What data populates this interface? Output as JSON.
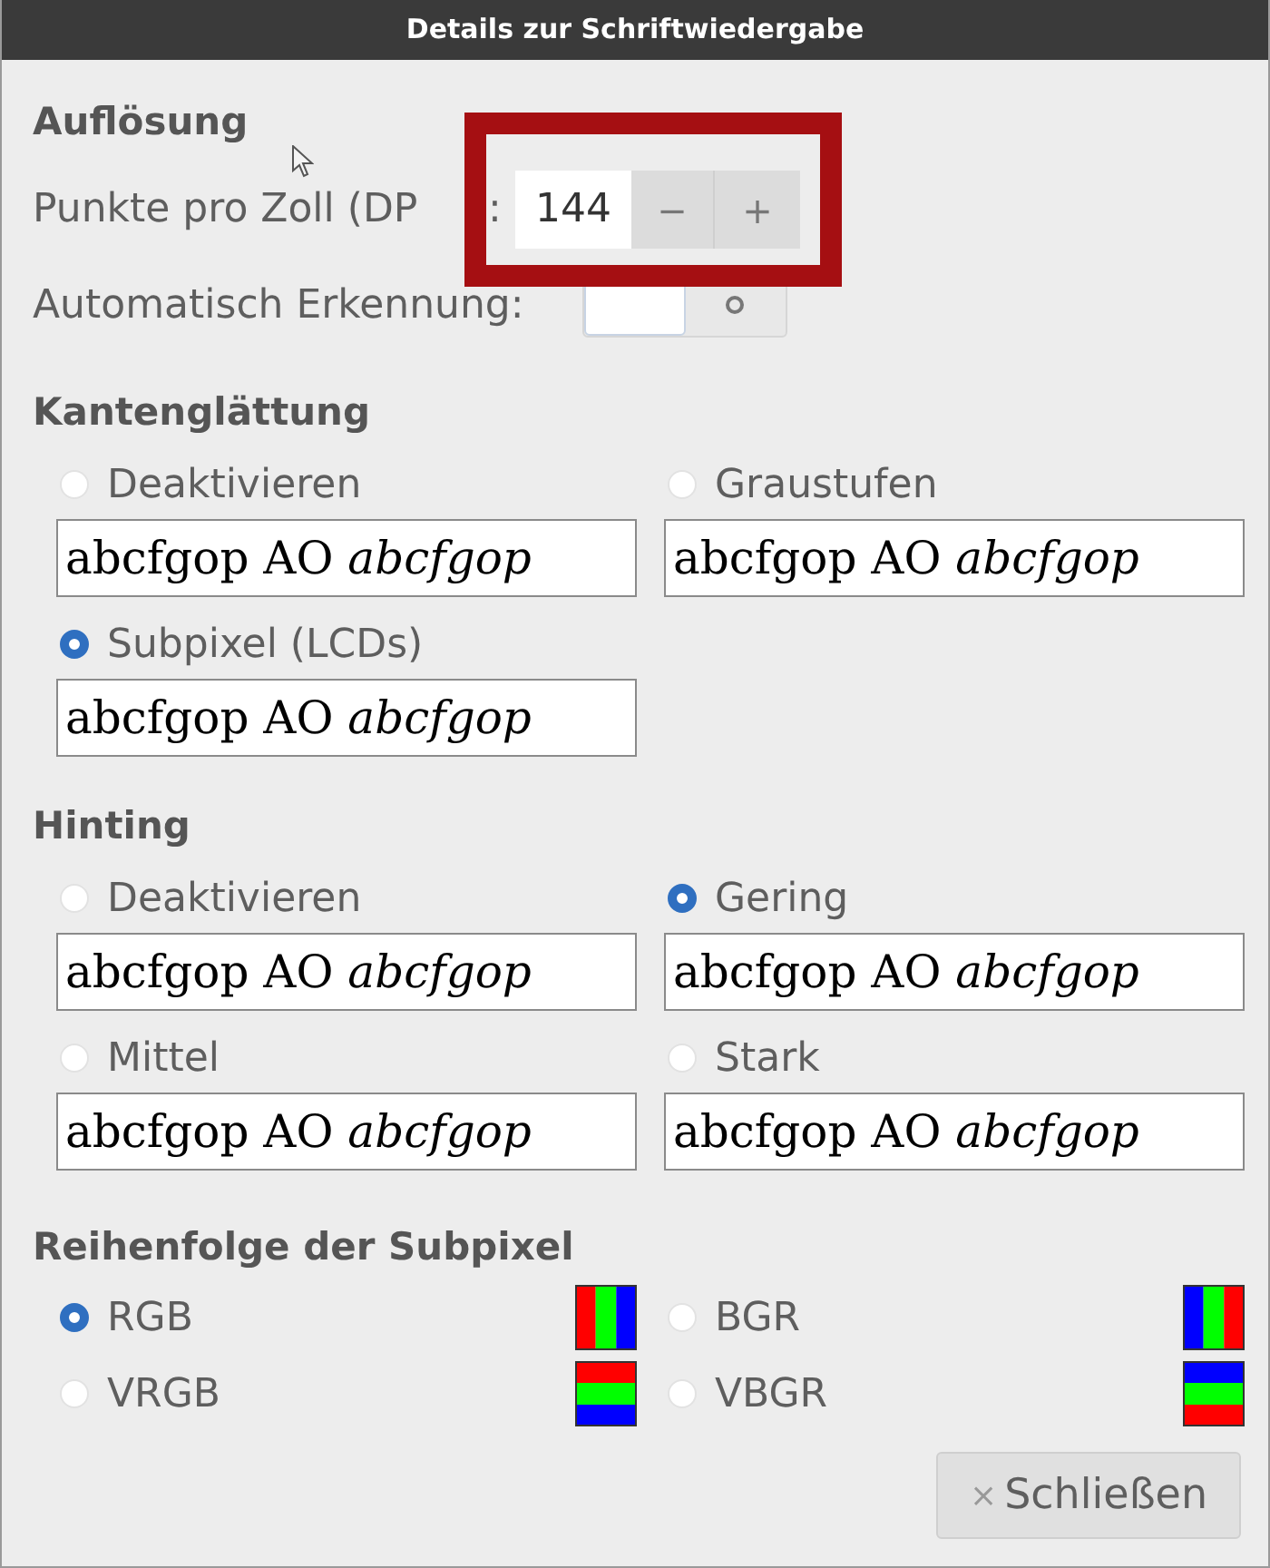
{
  "window": {
    "title": "Details zur Schriftwiedergabe"
  },
  "resolution": {
    "heading": "Auflösung",
    "dpi_label": "Punkte pro Zoll (DP",
    "dpi_colon": ":",
    "dpi_value": "144",
    "decrement": "−",
    "increment": "+",
    "auto_label": "Automatisch Erkennung:",
    "auto_on": false
  },
  "antialiasing": {
    "heading": "Kantenglättung",
    "options": [
      {
        "label": "Deaktivieren",
        "selected": false,
        "preview": "abcfgop AO *abcfgop*"
      },
      {
        "label": "Graustufen",
        "selected": false,
        "preview": "abcfgop AO *abcfgop*"
      },
      {
        "label": "Subpixel (LCDs)",
        "selected": true,
        "preview": "abcfgop AO *abcfgop*"
      }
    ]
  },
  "hinting": {
    "heading": "Hinting",
    "options": [
      {
        "label": "Deaktivieren",
        "selected": false,
        "preview": "abcfgop AO *abcfgop*"
      },
      {
        "label": "Gering",
        "selected": true,
        "preview": "abcfgop AO *abcfgop*"
      },
      {
        "label": "Mittel",
        "selected": false,
        "preview": "abcfgop AO *abcfgop*"
      },
      {
        "label": "Stark",
        "selected": false,
        "preview": "abcfgop AO *abcfgop*"
      }
    ]
  },
  "subpixel_order": {
    "heading": "Reihenfolge der Subpixel",
    "options": [
      {
        "label": "RGB",
        "selected": true,
        "kind": "vertical",
        "reversed": false
      },
      {
        "label": "BGR",
        "selected": false,
        "kind": "vertical",
        "reversed": true
      },
      {
        "label": "VRGB",
        "selected": false,
        "kind": "horizontal",
        "reversed": false
      },
      {
        "label": "VBGR",
        "selected": false,
        "kind": "horizontal",
        "reversed": true
      }
    ]
  },
  "close_button": {
    "icon": "×",
    "label": "Schließen"
  }
}
